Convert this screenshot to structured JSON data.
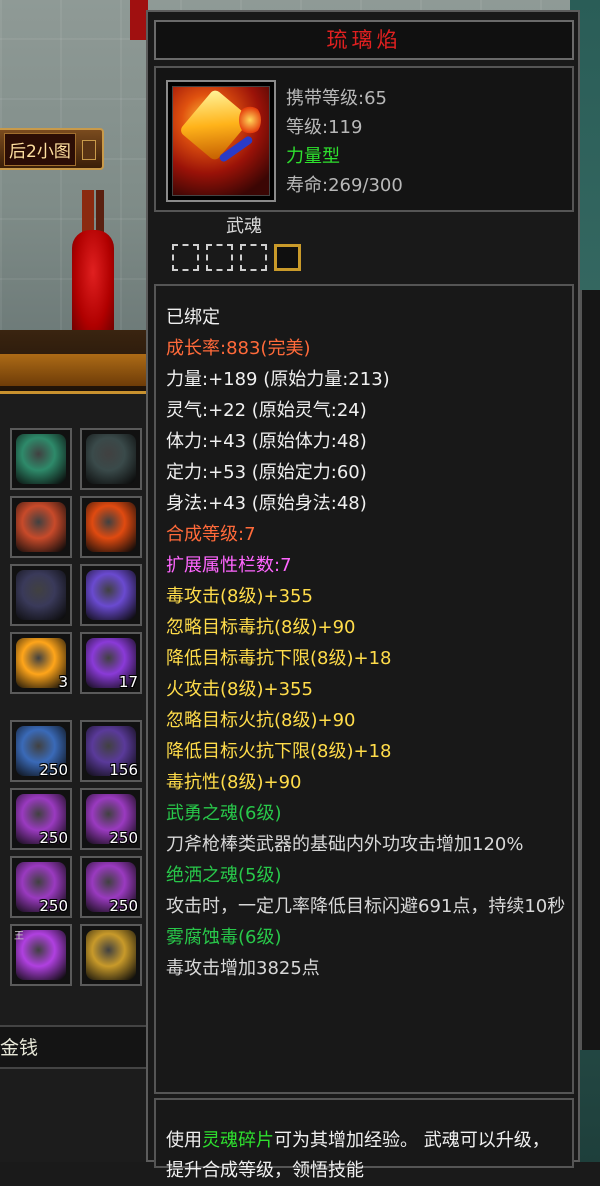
{
  "minimap_button": {
    "label": "后2小图"
  },
  "inventory": {
    "slots": [
      {
        "row": 0,
        "col": 0,
        "icon": "dragon-armor-icon",
        "color": "#2e8a6a",
        "count": ""
      },
      {
        "row": 0,
        "col": 1,
        "icon": "dark-armor-icon",
        "color": "#3a4a4a",
        "count": ""
      },
      {
        "row": 1,
        "col": 0,
        "icon": "fox-mask-icon",
        "color": "#c84a2a",
        "count": ""
      },
      {
        "row": 1,
        "col": 1,
        "icon": "fire-crystal-icon",
        "color": "#e04a10",
        "count": ""
      },
      {
        "row": 2,
        "col": 0,
        "icon": "dark-orb-icon",
        "color": "#3a3a5a",
        "count": ""
      },
      {
        "row": 2,
        "col": 1,
        "icon": "purple-spirit-icon",
        "color": "#6a4ad0",
        "count": ""
      },
      {
        "row": 3,
        "col": 0,
        "icon": "fire-spirit-icon",
        "color": "#ffa51a",
        "count": "3"
      },
      {
        "row": 3,
        "col": 1,
        "icon": "purple-flame-icon",
        "color": "#8a3ad8",
        "count": "17"
      },
      {
        "row": 4,
        "col": 0,
        "icon": "blue-potion-icon",
        "color": "#3a6ab8",
        "count": "250"
      },
      {
        "row": 4,
        "col": 1,
        "icon": "green-potion-icon",
        "color": "#5a3a9a",
        "count": "156"
      },
      {
        "row": 5,
        "col": 0,
        "icon": "purple-scroll-icon",
        "color": "#9a3ac0",
        "count": "250"
      },
      {
        "row": 5,
        "col": 1,
        "icon": "purple-scroll-icon",
        "color": "#9a3ac0",
        "count": "250"
      },
      {
        "row": 6,
        "col": 0,
        "icon": "purple-scroll-icon",
        "color": "#9a3ac0",
        "count": "250"
      },
      {
        "row": 6,
        "col": 1,
        "icon": "purple-scroll-icon",
        "color": "#9a3ac0",
        "count": "250"
      },
      {
        "row": 7,
        "col": 0,
        "icon": "purple-lotus-icon",
        "color": "#b040e0",
        "count": "",
        "mark": "王"
      },
      {
        "row": 7,
        "col": 1,
        "icon": "compass-icon",
        "color": "#c89a2a",
        "count": ""
      }
    ],
    "footer_label": "金钱"
  },
  "tooltip": {
    "title": "琉璃焰",
    "title_color": "#e02020",
    "carry_level": "携带等级:65",
    "level": "等级:119",
    "type": "力量型",
    "lifespan": "寿命:269/300",
    "wuhun_label": "武魂",
    "wuhun_slots": [
      "empty",
      "empty",
      "empty",
      "gold"
    ],
    "lines": [
      {
        "text": "已绑定",
        "color": "white"
      },
      {
        "text": "成长率:883(完美)",
        "color": "orange"
      },
      {
        "text": "力量:+189 (原始力量:213)",
        "color": "white"
      },
      {
        "text": "灵气:+22 (原始灵气:24)",
        "color": "white"
      },
      {
        "text": "体力:+43 (原始体力:48)",
        "color": "white"
      },
      {
        "text": "定力:+53 (原始定力:60)",
        "color": "white"
      },
      {
        "text": "身法:+43 (原始身法:48)",
        "color": "white"
      },
      {
        "text": "合成等级:7",
        "color": "orange"
      },
      {
        "text": "扩展属性栏数:7",
        "color": "pink"
      },
      {
        "text": "毒攻击(8级)+355",
        "color": "yellow"
      },
      {
        "text": "忽略目标毒抗(8级)+90",
        "color": "yellow"
      },
      {
        "text": "降低目标毒抗下限(8级)+18",
        "color": "yellow"
      },
      {
        "text": "火攻击(8级)+355",
        "color": "yellow"
      },
      {
        "text": "忽略目标火抗(8级)+90",
        "color": "yellow"
      },
      {
        "text": "降低目标火抗下限(8级)+18",
        "color": "yellow"
      },
      {
        "text": "毒抗性(8级)+90",
        "color": "yellow"
      },
      {
        "text": "武勇之魂(6级)",
        "color": "green"
      },
      {
        "text": "刀斧枪棒类武器的基础内外功攻击增加120%",
        "color": "desc",
        "wrap": true
      },
      {
        "text": "绝洒之魂(5级)",
        "color": "green"
      },
      {
        "text": "攻击时，一定几率降低目标闪避691点，持续10秒",
        "color": "desc",
        "wrap": true
      },
      {
        "text": "雾腐蚀毒(6级)",
        "color": "green"
      },
      {
        "text": "毒攻击增加3825点",
        "color": "desc"
      }
    ],
    "footer": {
      "prefix": "使用",
      "highlight": "灵魂碎片",
      "suffix": "可为其增加经验。 武魂可以升级，提升合成等级，领悟技能"
    }
  }
}
